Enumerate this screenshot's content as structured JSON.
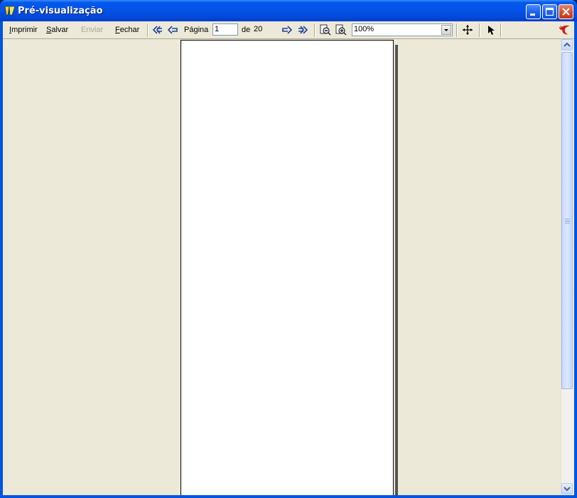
{
  "window": {
    "title": "Pré-visualização",
    "accent_color": "#0054e3",
    "controls": [
      "minimize-icon",
      "maximize-icon",
      "close-icon"
    ]
  },
  "toolbar": {
    "print": {
      "label": "Imprimir",
      "hotkey": "I",
      "rest": "mprimir"
    },
    "save": {
      "label": "Salvar",
      "hotkey": "S",
      "rest": "alvar"
    },
    "send": {
      "label": "Enviar",
      "disabled": true
    },
    "close": {
      "label": "Fechar",
      "hotkey": "F",
      "rest": "echar"
    },
    "nav_icons": [
      "first-page-icon",
      "previous-page-icon",
      "next-page-icon",
      "last-page-icon"
    ],
    "page_label": "Página",
    "page_value": "1",
    "of_label": "de",
    "total_pages": "20",
    "zoom_icons": [
      "zoom-out-icon",
      "zoom-in-icon"
    ],
    "zoom_value": "100%",
    "tool_icons": [
      "move-page-icon",
      "pointer-icon",
      "app-logo-icon"
    ]
  },
  "preview": {
    "page_color": "#ffffff",
    "background_color": "#ece9d8"
  }
}
